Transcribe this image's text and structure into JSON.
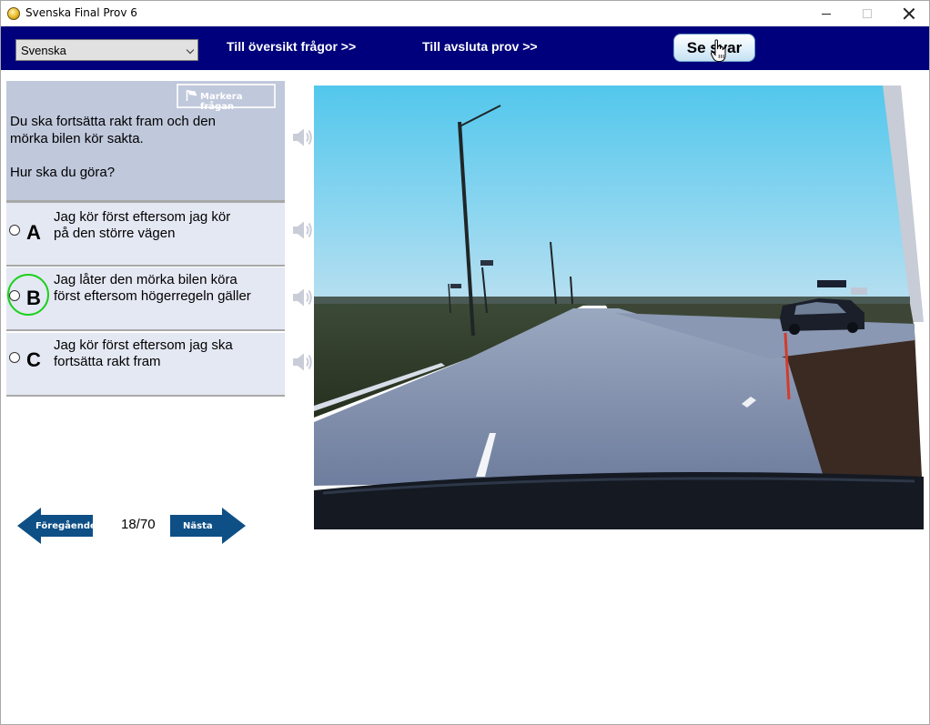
{
  "window": {
    "title": "Svenska Final Prov 6"
  },
  "toolbar": {
    "language_selected": "Svenska",
    "overview_link": "Till översikt frågor >>",
    "finish_link": "Till avsluta prov  >>",
    "show_answer_button": "Se svar"
  },
  "question": {
    "flag_button": "Markera frågan",
    "lines": [
      "Du ska fortsätta rakt fram och den",
      "mörka bilen kör sakta."
    ],
    "prompt": "Hur ska du göra?"
  },
  "answers": [
    {
      "letter": "A",
      "lines": [
        "Jag kör först eftersom jag kör",
        "på den större vägen"
      ],
      "selected": false
    },
    {
      "letter": "B",
      "lines": [
        "Jag låter den mörka bilen köra",
        "först eftersom högerregeln gäller"
      ],
      "selected": true
    },
    {
      "letter": "C",
      "lines": [
        "Jag kör först eftersom jag ska",
        "fortsätta rakt fram"
      ],
      "selected": false
    }
  ],
  "navigation": {
    "previous_label": "Föregående",
    "next_label": "Nästa",
    "counter": "18/70"
  },
  "colors": {
    "toolbar_bg": "#00007c",
    "question_bg": "#c0c8dc",
    "answer_bg": "#e4e8f3",
    "selection_ring": "#1bd11b",
    "nav_arrow": "#0e4f86"
  },
  "icons": {
    "app": "app-icon",
    "flag": "flag-icon",
    "speaker": "speaker-icon",
    "cursor": "hand-cursor-icon"
  }
}
